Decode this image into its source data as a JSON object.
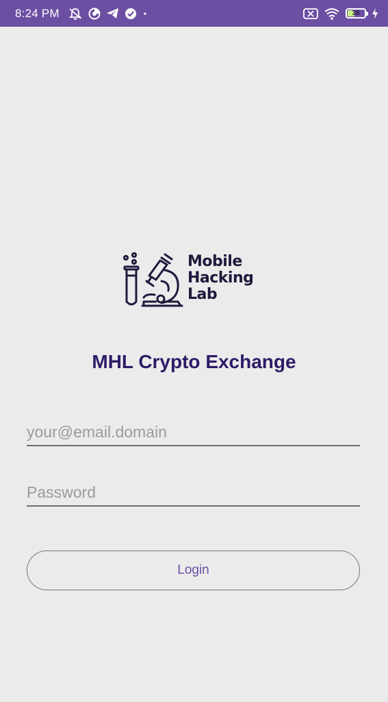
{
  "status_bar": {
    "time": "8:24 PM",
    "battery_level": "38",
    "left_icons": [
      "mute-notifications-icon",
      "data-saver-icon",
      "telegram-icon",
      "check-circle-icon",
      "dot-icon"
    ],
    "right_icons": [
      "sim-missing-icon",
      "wifi-icon",
      "battery-icon",
      "charging-icon"
    ],
    "background_color": "#6c4fa3"
  },
  "logo": {
    "line1": "Mobile",
    "line2": "Hacking",
    "line3": "Lab"
  },
  "app_title": "MHL Crypto Exchange",
  "form": {
    "email_placeholder": "your@email.domain",
    "email_value": "",
    "password_placeholder": "Password",
    "password_value": "",
    "login_label": "Login"
  },
  "colors": {
    "background": "#ebebeb",
    "title": "#2e1b67",
    "accent": "#6a4fa6"
  }
}
